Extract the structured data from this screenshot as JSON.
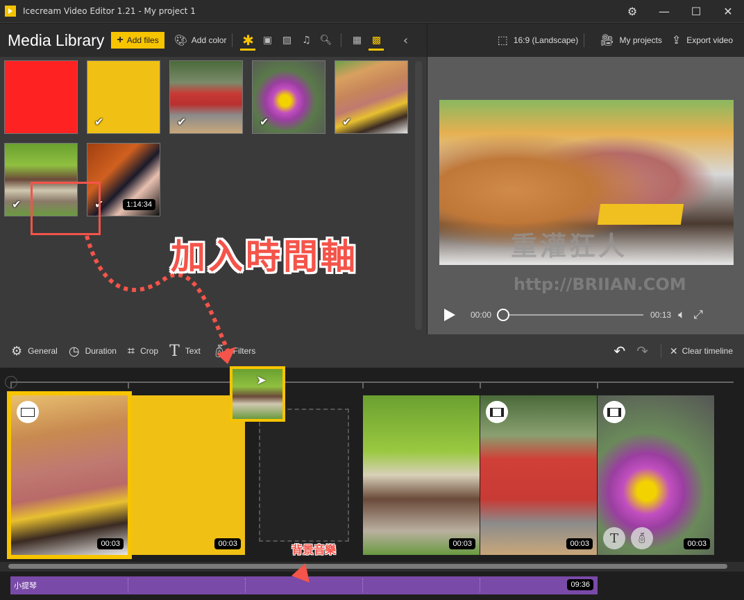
{
  "window": {
    "title": "Icecream Video Editor 1.21 - My project 1",
    "buttons": [
      "settings",
      "minimize",
      "maximize",
      "close"
    ]
  },
  "library": {
    "title": "Media Library",
    "add_files": "Add files",
    "add_color": "Add color",
    "filters": [
      "all",
      "video",
      "image",
      "audio",
      "search"
    ],
    "active_filter": "all",
    "view_modes": [
      "large-grid",
      "small-grid"
    ],
    "active_view": "small-grid",
    "items": [
      {
        "type": "color",
        "color": "#ff2222",
        "checked": false
      },
      {
        "type": "color",
        "color": "#f0c014",
        "checked": true
      },
      {
        "type": "image",
        "subject": "red megaphone sculpture",
        "checked": true
      },
      {
        "type": "image",
        "subject": "purple water lily",
        "checked": true
      },
      {
        "type": "image",
        "subject": "burger with bacon",
        "checked": true
      },
      {
        "type": "image",
        "subject": "old wooden building",
        "checked": true
      },
      {
        "type": "audio",
        "subject": "violin",
        "checked": true,
        "duration": "1:14:34"
      }
    ]
  },
  "preview_header": {
    "aspect": "16:9 (Landscape)",
    "my_projects": "My projects",
    "export": "Export video"
  },
  "player": {
    "current": "00:00",
    "total": "00:13",
    "progress": 0
  },
  "watermark": {
    "text": "重灌狂人",
    "url": "http://BRIIAN.COM"
  },
  "toolbar": {
    "general": "General",
    "duration": "Duration",
    "crop": "Crop",
    "text": "Text",
    "filters": "Filters",
    "clear": "Clear timeline"
  },
  "timeline": {
    "clips": [
      {
        "subject": "burger",
        "duration": "00:03",
        "selected": true
      },
      {
        "subject": "yellow color",
        "duration": "00:03"
      },
      {
        "subject": "old building",
        "duration": "00:03"
      },
      {
        "subject": "red megaphone",
        "duration": "00:03"
      },
      {
        "subject": "water lily",
        "duration": "00:03"
      }
    ],
    "audio": {
      "name": "小提琴",
      "duration": "09:36"
    }
  },
  "annotations": {
    "main": "加入時間軸",
    "audio": "背景音樂"
  }
}
